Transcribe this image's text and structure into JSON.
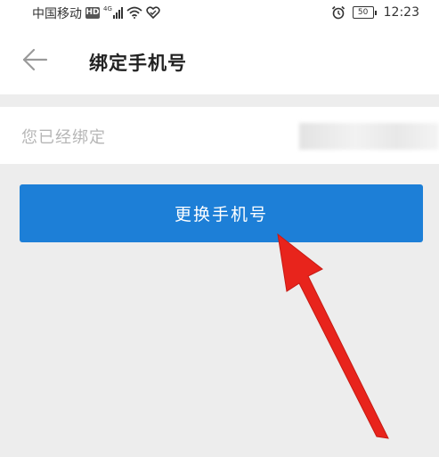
{
  "status_bar": {
    "carrier": "中国移动",
    "network_badge": "HD",
    "signal_type": "4G",
    "battery": "50",
    "time": "12:23",
    "icons": [
      "hd-badge-icon",
      "signal-icon",
      "wifi-icon",
      "heart-icon",
      "alarm-icon",
      "battery-icon"
    ]
  },
  "nav": {
    "title": "绑定手机号",
    "back_icon": "arrow-left-icon"
  },
  "bound": {
    "label": "您已经绑定"
  },
  "actions": {
    "change_phone": "更换手机号"
  },
  "annotation": {
    "color": "#e8241c"
  },
  "colors": {
    "primary": "#1d7fd7",
    "background": "#ededed",
    "label": "#b6b6b6"
  }
}
